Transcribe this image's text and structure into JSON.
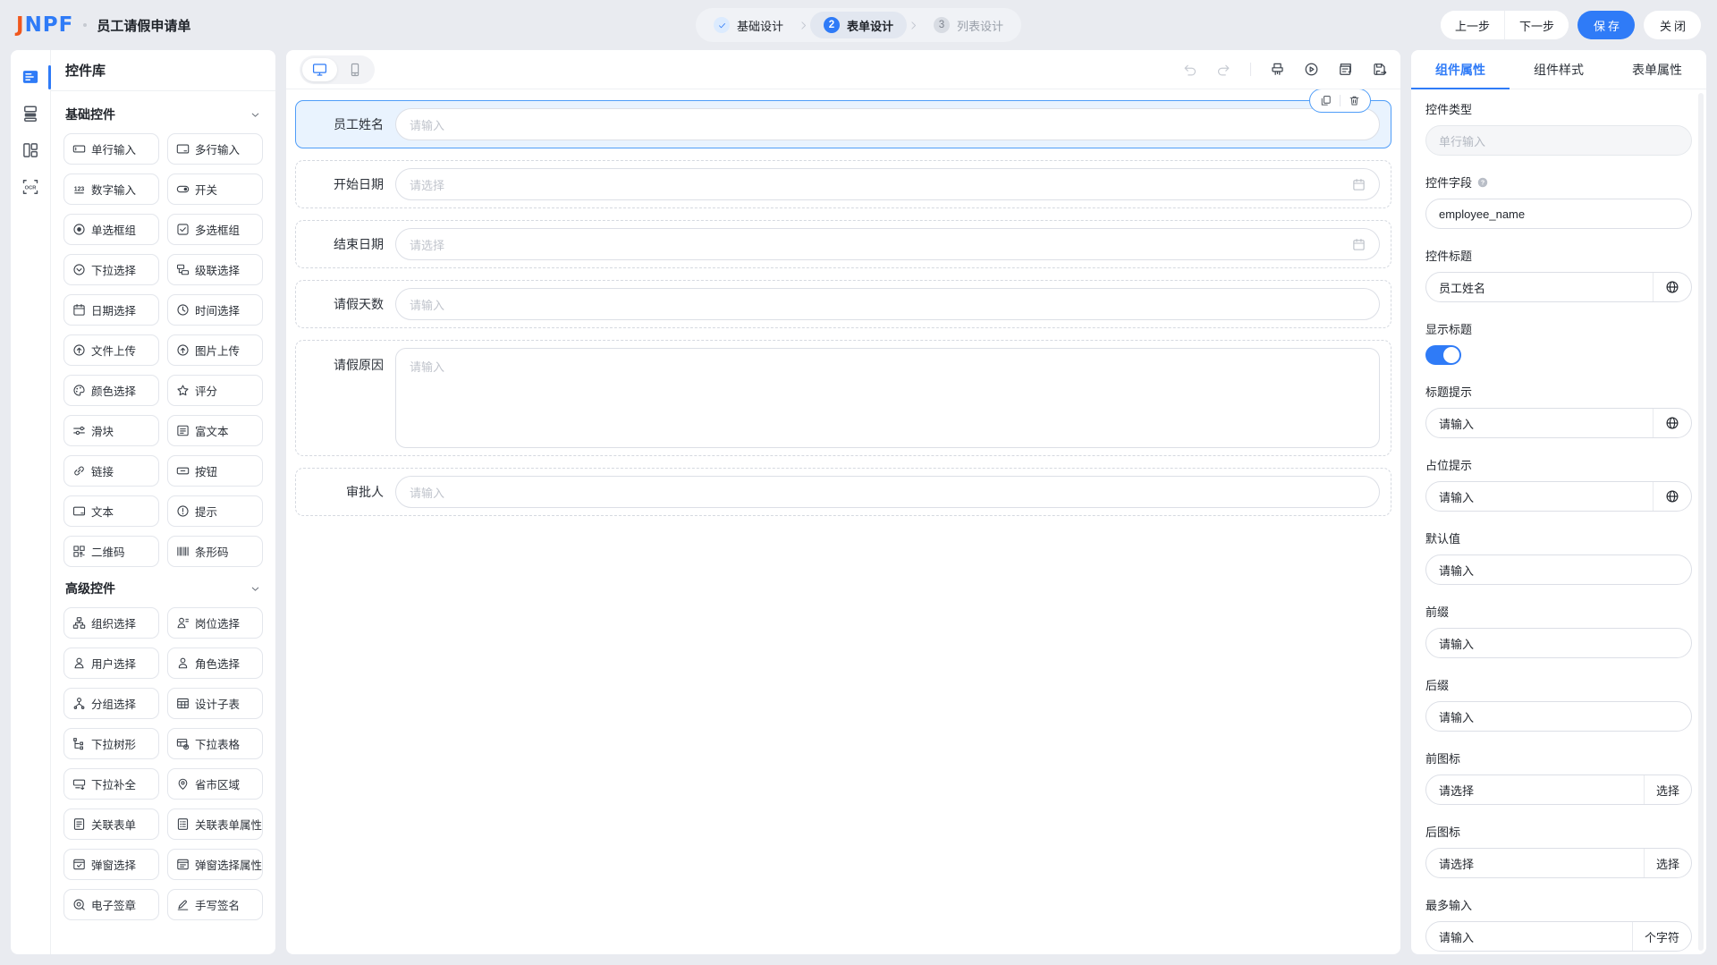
{
  "header": {
    "logo": {
      "first": "J",
      "rest": "NPF"
    },
    "title": "员工请假申请单",
    "steps": [
      {
        "number": "",
        "label": "基础设计",
        "status": "done"
      },
      {
        "number": "2",
        "label": "表单设计",
        "status": "active"
      },
      {
        "number": "3",
        "label": "列表设计",
        "status": "pending"
      }
    ],
    "actions": {
      "prev": "上一步",
      "next": "下一步",
      "save": "保存",
      "close": "关闭"
    }
  },
  "nav_rail": [
    {
      "icon": "widgets-icon",
      "active": true
    },
    {
      "icon": "form-layers-icon",
      "active": false
    },
    {
      "icon": "layout-icon",
      "active": false
    },
    {
      "icon": "ocr-icon",
      "active": false
    }
  ],
  "library": {
    "title": "控件库",
    "sections": [
      {
        "title": "基础控件",
        "items": [
          {
            "icon": "input-icon",
            "label": "单行输入"
          },
          {
            "icon": "textarea-icon",
            "label": "多行输入"
          },
          {
            "icon": "number-icon",
            "label": "数字输入"
          },
          {
            "icon": "switch-icon",
            "label": "开关"
          },
          {
            "icon": "radio-icon",
            "label": "单选框组"
          },
          {
            "icon": "checkbox-icon",
            "label": "多选框组"
          },
          {
            "icon": "select-icon",
            "label": "下拉选择"
          },
          {
            "icon": "cascade-icon",
            "label": "级联选择"
          },
          {
            "icon": "date-icon",
            "label": "日期选择"
          },
          {
            "icon": "time-icon",
            "label": "时间选择"
          },
          {
            "icon": "upload-icon",
            "label": "文件上传"
          },
          {
            "icon": "image-upload-icon",
            "label": "图片上传"
          },
          {
            "icon": "color-icon",
            "label": "颜色选择"
          },
          {
            "icon": "star-icon",
            "label": "评分"
          },
          {
            "icon": "slider-icon",
            "label": "滑块"
          },
          {
            "icon": "richtext-icon",
            "label": "富文本"
          },
          {
            "icon": "link-icon",
            "label": "链接"
          },
          {
            "icon": "button-icon",
            "label": "按钮"
          },
          {
            "icon": "text-icon",
            "label": "文本"
          },
          {
            "icon": "alert-icon",
            "label": "提示"
          },
          {
            "icon": "qrcode-icon",
            "label": "二维码"
          },
          {
            "icon": "barcode-icon",
            "label": "条形码"
          }
        ]
      },
      {
        "title": "高级控件",
        "items": [
          {
            "icon": "org-icon",
            "label": "组织选择"
          },
          {
            "icon": "post-icon",
            "label": "岗位选择"
          },
          {
            "icon": "user-icon",
            "label": "用户选择"
          },
          {
            "icon": "role-icon",
            "label": "角色选择"
          },
          {
            "icon": "group-icon",
            "label": "分组选择"
          },
          {
            "icon": "subtable-icon",
            "label": "设计子表"
          },
          {
            "icon": "tree-icon",
            "label": "下拉树形"
          },
          {
            "icon": "dropdown-table-icon",
            "label": "下拉表格"
          },
          {
            "icon": "autocomplete-icon",
            "label": "下拉补全"
          },
          {
            "icon": "region-icon",
            "label": "省市区域"
          },
          {
            "icon": "form-icon",
            "label": "关联表单"
          },
          {
            "icon": "form-attr-icon",
            "label": "关联表单属性"
          },
          {
            "icon": "popup-icon",
            "label": "弹窗选择"
          },
          {
            "icon": "popup-attr-icon",
            "label": "弹窗选择属性"
          },
          {
            "icon": "stamp-icon",
            "label": "电子签章"
          },
          {
            "icon": "sign-icon",
            "label": "手写签名"
          }
        ]
      }
    ]
  },
  "canvas": {
    "fields": [
      {
        "label": "员工姓名",
        "placeholder": "请输入",
        "type": "input",
        "selected": true
      },
      {
        "label": "开始日期",
        "placeholder": "请选择",
        "type": "date",
        "selected": false
      },
      {
        "label": "结束日期",
        "placeholder": "请选择",
        "type": "date",
        "selected": false
      },
      {
        "label": "请假天数",
        "placeholder": "请输入",
        "type": "input",
        "selected": false
      },
      {
        "label": "请假原因",
        "placeholder": "请输入",
        "type": "textarea",
        "selected": false
      },
      {
        "label": "审批人",
        "placeholder": "请输入",
        "type": "input",
        "selected": false
      }
    ]
  },
  "inspector": {
    "tabs": [
      "组件属性",
      "组件样式",
      "表单属性"
    ],
    "active_tab": "组件属性",
    "fields": [
      {
        "label": "控件类型",
        "type": "input",
        "value": "单行输入",
        "disabled": true
      },
      {
        "label": "控件字段",
        "type": "input",
        "value": "employee_name",
        "help": true
      },
      {
        "label": "控件标题",
        "type": "input",
        "value": "员工姓名",
        "append": "globe"
      },
      {
        "label": "显示标题",
        "type": "switch",
        "on": true
      },
      {
        "label": "标题提示",
        "type": "input",
        "placeholder": "请输入",
        "append": "globe"
      },
      {
        "label": "占位提示",
        "type": "input",
        "value": "请输入",
        "append": "globe"
      },
      {
        "label": "默认值",
        "type": "input",
        "placeholder": "请输入"
      },
      {
        "label": "前缀",
        "type": "input",
        "placeholder": "请输入"
      },
      {
        "label": "后缀",
        "type": "input",
        "placeholder": "请输入"
      },
      {
        "label": "前图标",
        "type": "input",
        "placeholder": "请选择",
        "append_text": "选择"
      },
      {
        "label": "后图标",
        "type": "input",
        "placeholder": "请选择",
        "append_text": "选择"
      },
      {
        "label": "最多输入",
        "type": "input",
        "placeholder": "请输入",
        "append_text": "个字符"
      }
    ]
  }
}
